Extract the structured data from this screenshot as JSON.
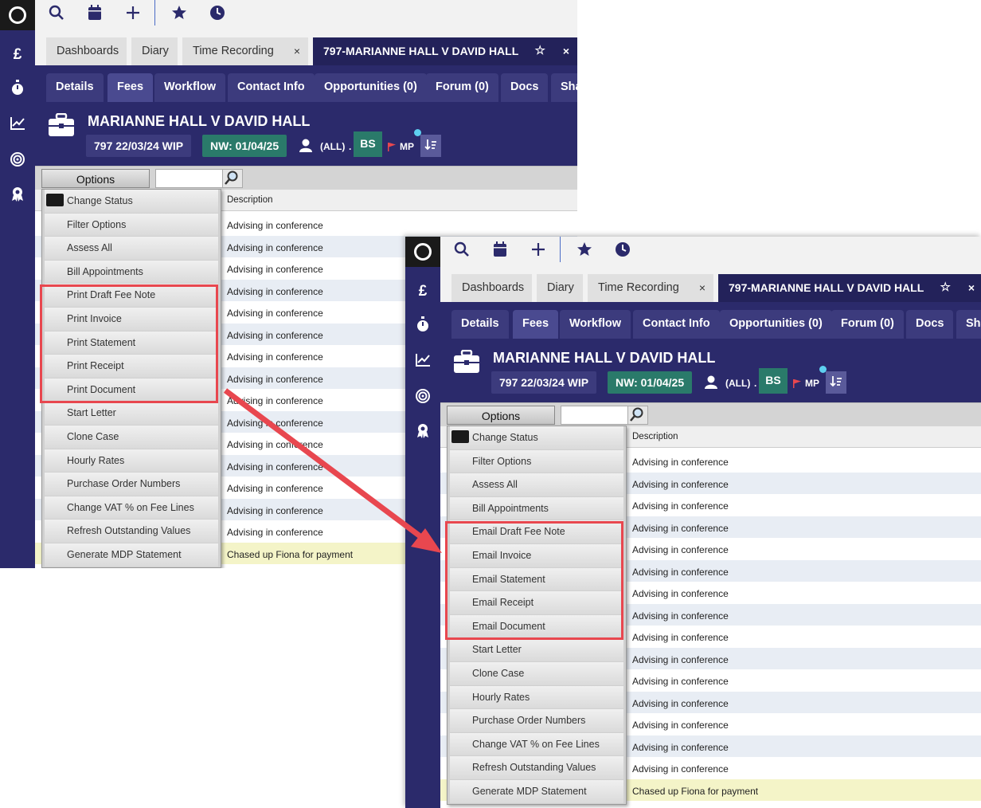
{
  "toolbar": {
    "icons": [
      "search-icon",
      "calendar-icon",
      "plus-icon",
      "star-icon",
      "clock-icon"
    ]
  },
  "sidebar": {
    "icons": [
      "pound-icon",
      "stopwatch-icon",
      "chart-icon",
      "target-icon",
      "award-icon"
    ],
    "pound": "£"
  },
  "tabs": [
    {
      "label": "Dashboards"
    },
    {
      "label": "Diary"
    },
    {
      "label": "Time Recording"
    },
    {
      "label": "797-MARIANNE HALL V DAVID HALL"
    }
  ],
  "close_glyph": "×",
  "star_glyph": "☆",
  "subtabs": [
    "Details",
    "Fees",
    "Workflow",
    "Contact Info",
    "Opportunities (0)",
    "Forum (0)",
    "Docs",
    "Sha"
  ],
  "case": {
    "title": "MARIANNE HALL V DAVID HALL",
    "wip": "797 22/03/24 WIP",
    "nw": "NW: 01/04/25",
    "all": "(ALL)",
    "dot": ".",
    "initials": "BS",
    "mp": "MP"
  },
  "options_label": "Options",
  "column_header": "Description",
  "row_text": "Advising in conference",
  "last_row_text": "Chased up Fiona for payment",
  "menu_before": [
    "Change Status",
    "Filter Options",
    "Assess All",
    "Bill Appointments"
  ],
  "menu_print": [
    "Print Draft Fee Note",
    "Print Invoice",
    "Print Statement",
    "Print Receipt",
    "Print Document"
  ],
  "menu_email": [
    "Email Draft Fee Note",
    "Email Invoice",
    "Email Statement",
    "Email Receipt",
    "Email Document"
  ],
  "menu_after": [
    "Start Letter",
    "Clone Case",
    "Hourly Rates",
    "Purchase Order Numbers",
    "Change VAT % on Fee Lines",
    "Refresh Outstanding Values",
    "Generate MDP Statement"
  ],
  "colors": {
    "sidebar": "#2b2a6b",
    "highlight": "#e8474f",
    "nw_badge": "#2a7a6a",
    "bs_badge": "#2a7a6a"
  }
}
